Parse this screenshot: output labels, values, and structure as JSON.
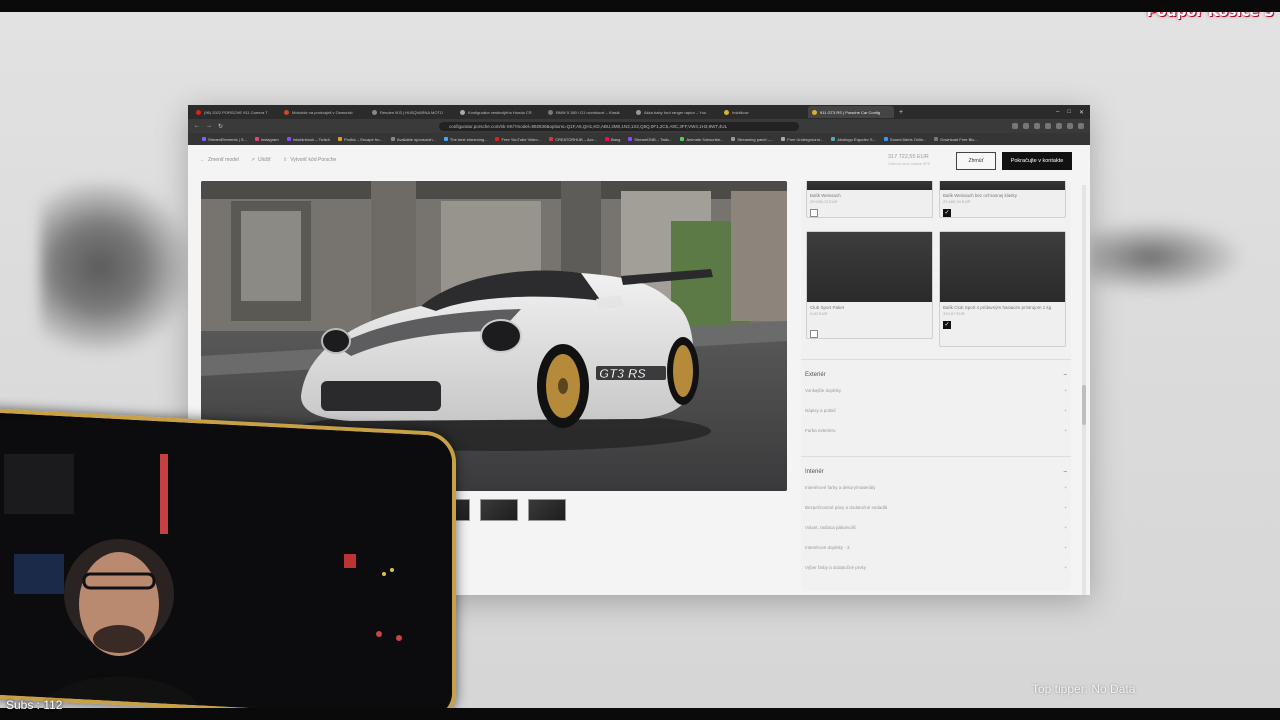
{
  "overlay": {
    "promo_text": "Podpor Košice S",
    "subs_text": "Subs : 112",
    "tipper_text": "Top tipper: No Data"
  },
  "browser": {
    "tabs": [
      {
        "label": "(96) 2022 PORSCHE 911 Carrera T",
        "color": "#e02020",
        "active": false
      },
      {
        "label": "Motoride na prodvajeli v Osmorski",
        "color": "#c94a2a",
        "active": false
      },
      {
        "label": "Renden 903 | HUSQVARNA MOTO",
        "color": "#888888",
        "active": false
      },
      {
        "label": "Konfigurátor vestincijého Honda CR",
        "color": "#aaaaaa",
        "active": false
      },
      {
        "label": "BMW 5 380 i G1 novinkové – Klasik",
        "color": "#777777",
        "active": false
      },
      {
        "label": "Akka baby ford ranger raptor – You",
        "color": "#999999",
        "active": false
      },
      {
        "label": "Insblikow",
        "color": "#d6b32c",
        "active": false
      },
      {
        "label": "911 GT3 RS | Porsche Car Config",
        "color": "#d6b32c",
        "active": true
      }
    ],
    "url": "configurator.porsche.com/sk-SK/?model=992830&options=Q1F,A6,QH1,KD,ABU,2M0,1N3,1X2,Q5Q,0F1,2C5,A8C,3FF,VW4,1H3,9WT,4UL",
    "bookmarks": [
      {
        "label": "StreamElements | S...",
        "color": "#7b61ff"
      },
      {
        "label": "Instagram",
        "color": "#e0457b"
      },
      {
        "label": "Inkubinbook – Twitch",
        "color": "#9146ff"
      },
      {
        "label": "Prolkic – Escape fro...",
        "color": "#e5a11a"
      },
      {
        "label": "Available sponsorsh...",
        "color": "#888888"
      },
      {
        "label": "The best streaming...",
        "color": "#4aa3ff"
      },
      {
        "label": "Free YouTube Video...",
        "color": "#e02020"
      },
      {
        "label": "CREATORHUB – Acc...",
        "color": "#d33"
      },
      {
        "label": "Bang",
        "color": "#f06"
      },
      {
        "label": "StreamDNB – Twitc...",
        "color": "#9146ff"
      },
      {
        "label": "Animate Subscribe...",
        "color": "#5c5"
      },
      {
        "label": "Streaming panel –...",
        "color": "#999"
      },
      {
        "label": "Free Underground...",
        "color": "#aaa"
      },
      {
        "label": "Abollogo Ergodev S...",
        "color": "#5aa"
      },
      {
        "label": "Sound Alerts Onlin...",
        "color": "#39f"
      },
      {
        "label": "Download Free Blo...",
        "color": "#777"
      }
    ]
  },
  "page": {
    "crumbs": [
      {
        "icon": "←",
        "label": "Zmeniť model"
      },
      {
        "icon": "↗",
        "label": "Uložiť"
      },
      {
        "icon": "⇪",
        "label": "Vytvoriť kód Porsche"
      }
    ],
    "price": "317 722,55 EUR",
    "price_note": "Celková cena vrátane DPH",
    "save_label": "Zhrnúť",
    "contact_label": "Pokračujte v kontakte"
  },
  "options": [
    {
      "name": "Balík Weissach",
      "price": "29 045,03 EUR",
      "checked": false
    },
    {
      "name": "Balík Weissach bez ochrannej klietky",
      "price": "29 480,34 EUR",
      "checked": true
    },
    {
      "name": "Club Sport Paket",
      "price": "0,00 EUR",
      "checked": false
    },
    {
      "name": "Balík Club Sport s prídavným hasiacim prístrojom 1 kg",
      "price": "319,07 EUR",
      "checked": true
    }
  ],
  "sections": [
    {
      "title": "Exteriér",
      "rows": [
        "Vonkajšie doplnky",
        "Nápisy a potlač",
        "Farba exteriéru"
      ]
    },
    {
      "title": "Interiér",
      "rows": [
        "Interiérové farby a dekory/materiály",
        "Bezpečnostné pásy a dodatočné sedadlá",
        "Volant, radiaca páka/volič",
        "Interiérové doplnky · 3",
        "Výber farby a dodatočné prvky"
      ]
    }
  ]
}
